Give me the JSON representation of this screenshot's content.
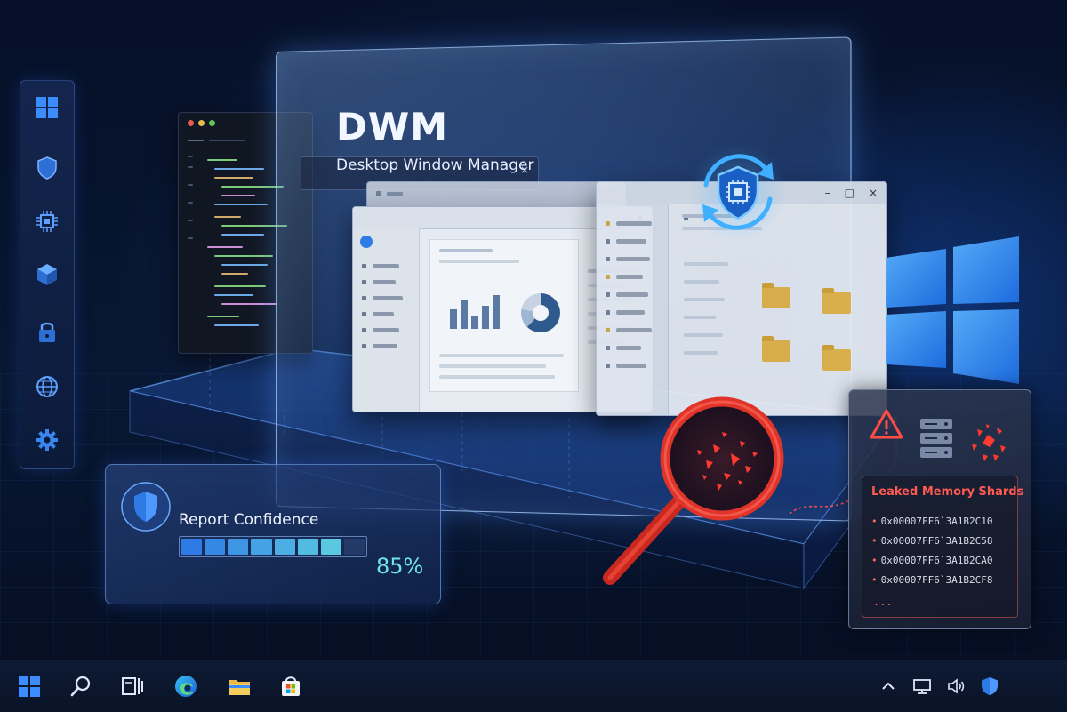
{
  "dwm": {
    "title": "DWM",
    "subtitle": "Desktop Window Manager"
  },
  "report_confidence": {
    "label": "Report Confidence",
    "percent_text": "85%",
    "value": 0.85
  },
  "leak_panel": {
    "title": "Leaked Memory Shards",
    "addresses": [
      "0x00007FF6`3A1B2C10",
      "0x00007FF6`3A1B2C58",
      "0x00007FF6`3A1B2CA0",
      "0x00007FF6`3A1B2CF8"
    ],
    "more": "..."
  },
  "colors": {
    "accent_blue": "#2f7be6",
    "confidence_teal": "#6fe3e6",
    "alert_red": "#ff5a52",
    "glass_border": "#aad2ff",
    "folder_yellow": "#e8b94a"
  },
  "window_controls": {
    "minimize": "–",
    "maximize": "□",
    "close": "×"
  },
  "left_rail_icons": [
    "windows-icon",
    "shield-icon",
    "chip-icon",
    "cube-icon",
    "lock-icon",
    "globe-icon",
    "gear-icon"
  ],
  "taskbar_icons": [
    "start-icon",
    "search-icon",
    "task-view-icon",
    "edge-icon",
    "file-explorer-icon",
    "store-icon"
  ],
  "tray_icons": [
    "chevron-up-icon",
    "network-icon",
    "volume-icon",
    "security-shield-icon"
  ]
}
